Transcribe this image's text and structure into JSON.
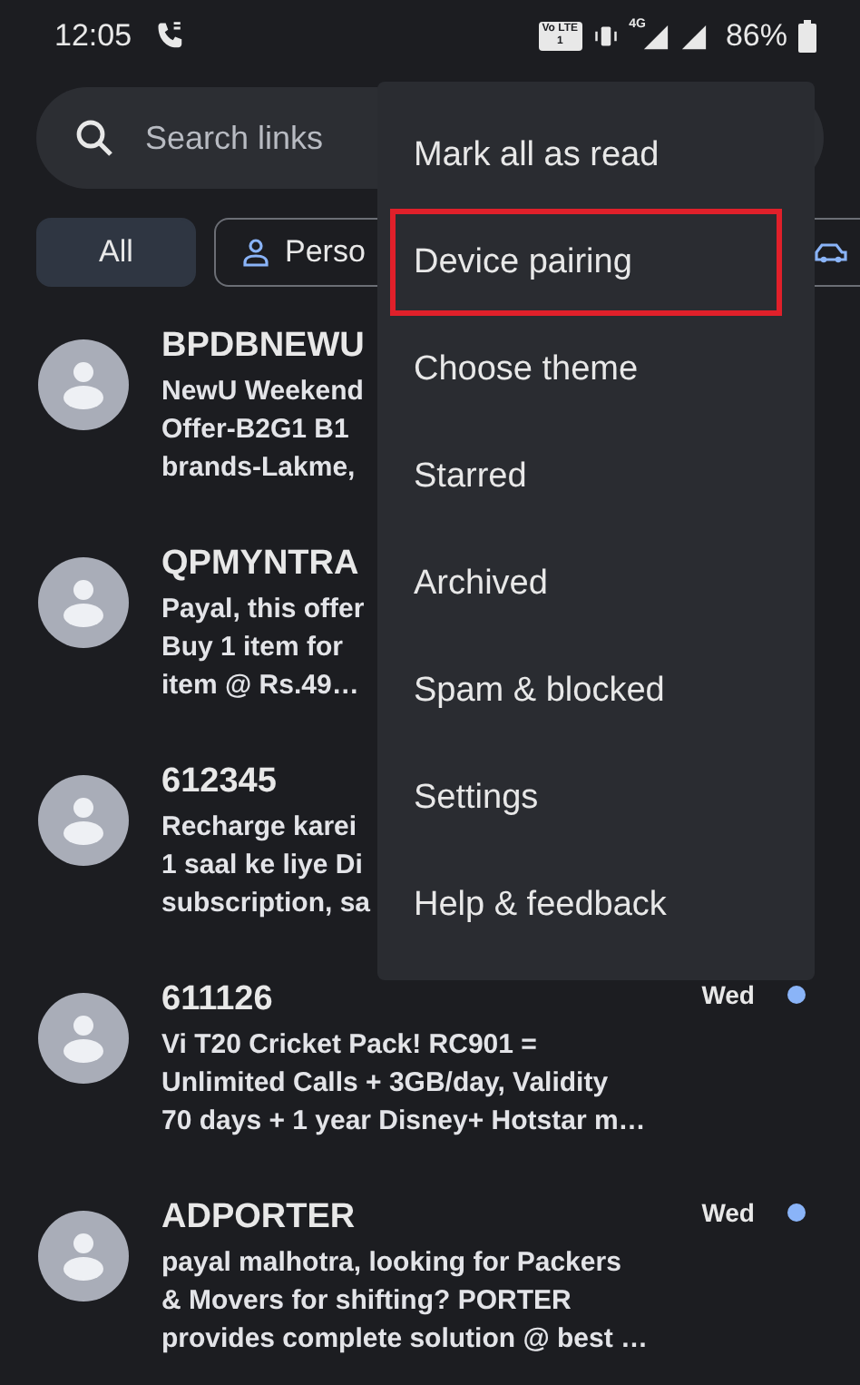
{
  "status_bar": {
    "time": "12:05",
    "volte": "Vo LTE 1",
    "network": "4G",
    "battery": "86%"
  },
  "search": {
    "placeholder": "Search links"
  },
  "chips": [
    {
      "label": "All",
      "selected": true,
      "kind": "text"
    },
    {
      "label": "Perso",
      "selected": false,
      "kind": "person"
    },
    {
      "selected": false,
      "kind": "icon"
    }
  ],
  "messages": [
    {
      "sender": "BPDBNEWU",
      "lines": [
        "NewU Weekend",
        "Offer-B2G1 B1",
        "brands-Lakme,"
      ]
    },
    {
      "sender": "QPMYNTRA",
      "lines": [
        "Payal, this offer",
        "Buy 1 item for",
        "item @ Rs.49…"
      ]
    },
    {
      "sender": "612345",
      "lines": [
        "Recharge karei",
        "1 saal ke liye Di",
        "subscription, sa"
      ]
    },
    {
      "sender": "611126",
      "lines": [
        "Vi T20 Cricket Pack! RC901 =",
        "Unlimited Calls + 3GB/day, Validity",
        "70 days + 1 year Disney+ Hotstar m…"
      ],
      "time": "Wed",
      "unread": true
    },
    {
      "sender": "ADPORTER",
      "lines": [
        "payal malhotra, looking for Packers",
        "& Movers for shifting? PORTER",
        "provides complete solution @ best …"
      ],
      "time": "Wed",
      "unread": true
    }
  ],
  "menu": [
    {
      "label": "Mark all as read",
      "highlighted": false
    },
    {
      "label": "Device pairing",
      "highlighted": true
    },
    {
      "label": "Choose theme",
      "highlighted": false
    },
    {
      "label": "Starred",
      "highlighted": false
    },
    {
      "label": "Archived",
      "highlighted": false
    },
    {
      "label": "Spam & blocked",
      "highlighted": false
    },
    {
      "label": "Settings",
      "highlighted": false
    },
    {
      "label": "Help & feedback",
      "highlighted": false
    }
  ]
}
